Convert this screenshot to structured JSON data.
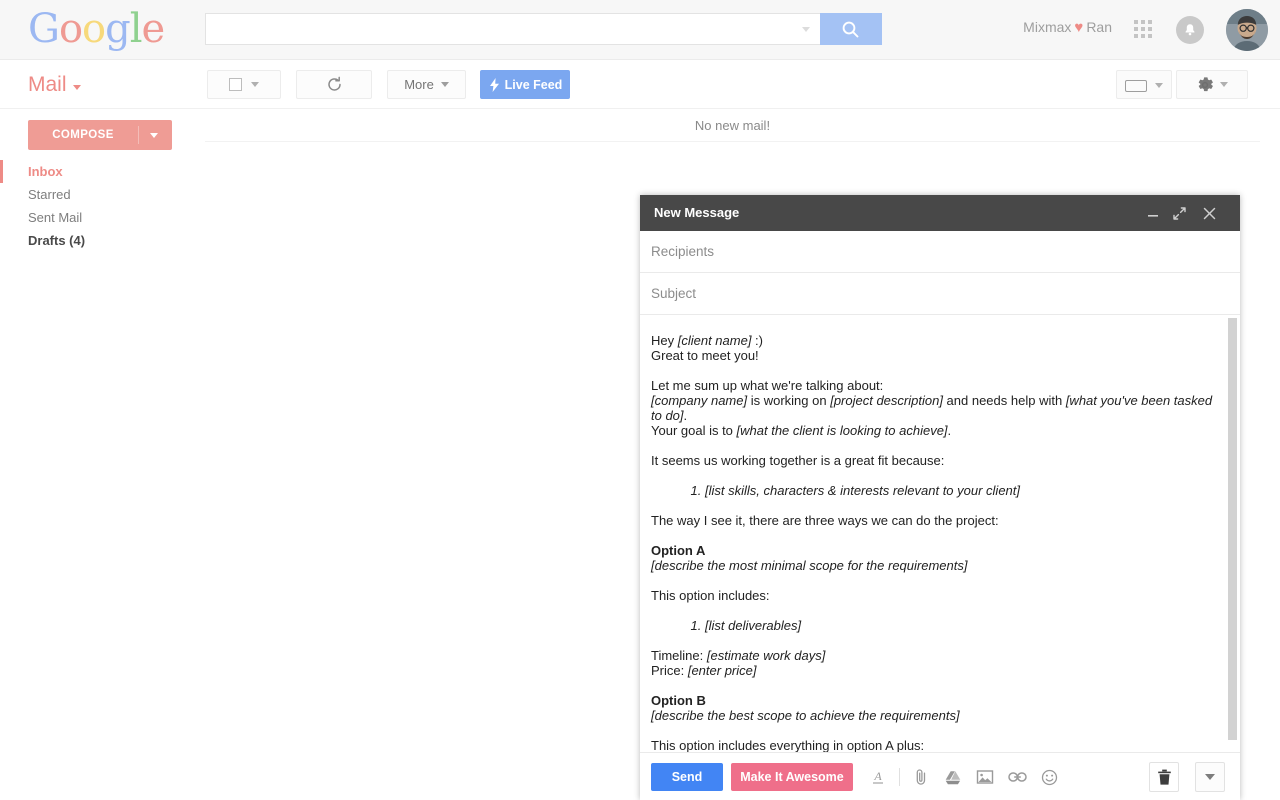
{
  "topbar": {
    "logo_letters": [
      "G",
      "o",
      "o",
      "g",
      "l",
      "e"
    ],
    "search": {
      "value": "",
      "placeholder": ""
    },
    "mixmax_prefix": "Mixmax",
    "mixmax_heart": "♥",
    "mixmax_user": "Ran",
    "apps_icon": "apps-grid-icon",
    "bell_icon": "notifications-bell-icon",
    "avatar_icon": "user-avatar"
  },
  "mailbar": {
    "title": "Mail",
    "select_label": "",
    "refresh_label": "",
    "more_label": "More",
    "live_feed_label": "Live Feed",
    "keyboard_icon": "keyboard-icon",
    "gear_icon": "gear-icon"
  },
  "sidebar": {
    "compose_label": "COMPOSE",
    "items": [
      {
        "label": "Inbox",
        "state": "active"
      },
      {
        "label": "Starred",
        "state": "normal"
      },
      {
        "label": "Sent Mail",
        "state": "normal"
      },
      {
        "label": "Drafts (4)",
        "state": "strong"
      }
    ]
  },
  "messagelist": {
    "empty_text": "No new mail!"
  },
  "compose": {
    "title": "New Message",
    "minimize_icon": "minimize-icon",
    "expand_icon": "expand-icon",
    "close_icon": "close-icon",
    "recipients_placeholder": "Recipients",
    "subject_placeholder": "Subject",
    "body": {
      "greeting_line1_pre": "Hey ",
      "greeting_line1_ph": "[client name]",
      "greeting_line1_post": " :)",
      "greeting_line2": "Great to meet you!",
      "summary_intro": "Let me sum up what we're talking about:",
      "summary_company_ph": "[company name]",
      "summary_mid1": " is working on ",
      "summary_project_ph": "[project description]",
      "summary_mid2": " and needs help with ",
      "summary_task_ph": "[what you've been tasked to do]",
      "summary_end": ".",
      "goal_pre": "Your goal is to ",
      "goal_ph": "[what the client is looking to achieve]",
      "goal_post": ".",
      "fit_intro": "It seems us working together is a great fit because:",
      "fit_item1": "[list skills, characters & interests relevant to your client]",
      "three_ways": "The way I see it, there are three ways we can do the project:",
      "option_a_title": "Option A",
      "option_a_desc": "[describe the most minimal scope for the requirements]",
      "includes_label": "This option includes:",
      "deliverables_item1": "[list deliverables]",
      "timeline_label": "Timeline: ",
      "timeline_ph": "[estimate work days]",
      "price_label": "Price: ",
      "price_ph": "[enter price]",
      "option_b_title": "Option B",
      "option_b_desc": "[describe the best scope to achieve the requirements]",
      "option_b_includes": "This option includes everything in option A plus:"
    },
    "footer": {
      "send_label": "Send",
      "awesome_label": "Make It Awesome",
      "format_icon": "format-text-icon",
      "attach_icon": "paperclip-attach-icon",
      "drive_icon": "google-drive-icon",
      "photo_icon": "insert-photo-icon",
      "link_icon": "insert-link-icon",
      "emoji_icon": "emoji-smiley-icon",
      "trash_icon": "trash-delete-icon",
      "more_options_icon": "more-options-caret-icon"
    }
  },
  "colors": {
    "accent_salmon": "#ee8b86",
    "send_blue": "#4285f4",
    "awesome_pink": "#ef6f8a",
    "livefeed_blue": "#7ba7f0",
    "compose_header": "#484848"
  }
}
